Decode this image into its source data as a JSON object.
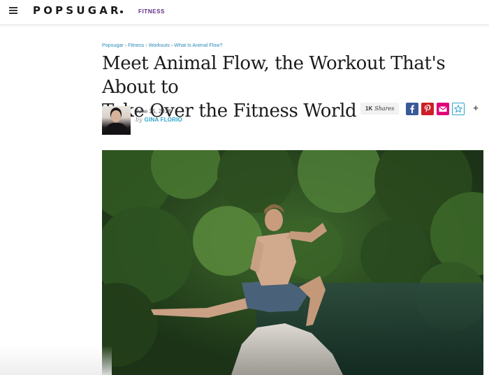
{
  "header": {
    "logo": "POPSUGAR",
    "section": "FITNESS"
  },
  "breadcrumbs": [
    "Popsugar",
    "Fitness",
    "Workouts",
    "What Is Animal Flow?"
  ],
  "article": {
    "title_line1": "Meet Animal Flow, the Workout That's About to",
    "title_line2": "Take Over the Fitness World",
    "date": "June 25, 2018",
    "by": "by",
    "author": "GINA FLORIO"
  },
  "shares": {
    "count": "1K",
    "label": "Shares"
  },
  "social_icons": [
    "facebook-icon",
    "pinterest-icon",
    "mail-icon",
    "favorite-icon",
    "plus-icon"
  ],
  "colors": {
    "brand_purple": "#5b2a86",
    "link_blue": "#2aa3c9",
    "facebook": "#3b5998",
    "pinterest": "#cb2027",
    "mail": "#e0007a"
  }
}
